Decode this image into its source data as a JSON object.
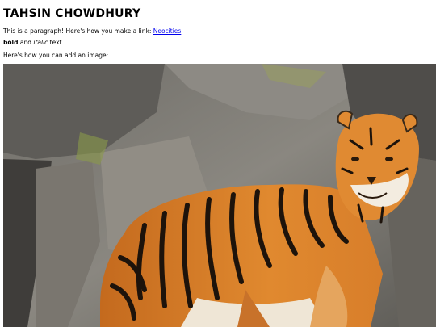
{
  "page": {
    "title": "TAHSIN CHOWDHURY",
    "paragraph1": {
      "text_before_link": "This is a paragraph! Here's how you make a link: ",
      "link_text": "Neocities",
      "text_after_link": "."
    },
    "paragraph2": {
      "bold_text": "bold",
      "middle_text": " and ",
      "italic_text": "italic",
      "end_text": " text."
    },
    "paragraph3": "Here's how you can add an image:"
  },
  "colors": {
    "link": "#0000ee",
    "tiger_orange": "#d9822b"
  },
  "image": {
    "subject_icon": "tiger-photo"
  }
}
